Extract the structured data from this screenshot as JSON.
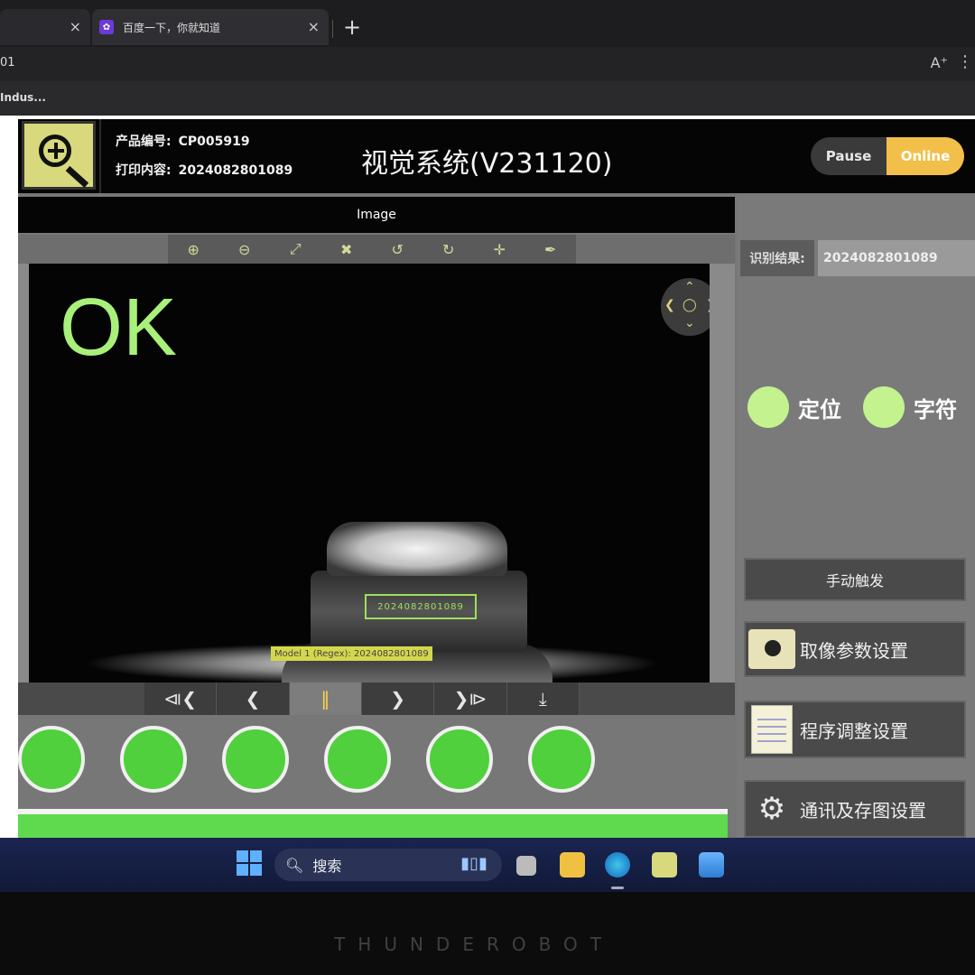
{
  "browser": {
    "tab1_close": "×",
    "tab2_title": "百度一下，你就知道",
    "tab2_close": "×",
    "new_tab": "+",
    "url_fragment": "01",
    "reader_icon": "A⁺",
    "favorite_fragment": "Indus..."
  },
  "header": {
    "product_no_label": "产品编号:",
    "product_no": "CP005919",
    "print_label": "打印内容:",
    "print_content": "2024082801089",
    "title": "视觉系统(V231120)",
    "pause_label": "Pause",
    "online_label": "Online"
  },
  "image_panel": {
    "title": "Image",
    "tools": [
      {
        "name": "zoom-in-icon",
        "glyph": "⊕"
      },
      {
        "name": "zoom-out-icon",
        "glyph": "⊖"
      },
      {
        "name": "fit-icon",
        "glyph": "⤢"
      },
      {
        "name": "expand-icon",
        "glyph": "✖"
      },
      {
        "name": "rotate-left-icon",
        "glyph": "↺"
      },
      {
        "name": "rotate-right-icon",
        "glyph": "↻"
      },
      {
        "name": "move-icon",
        "glyph": "✛"
      },
      {
        "name": "picker-icon",
        "glyph": "✒"
      }
    ],
    "ok_text": "OK",
    "code_text": "2024082801089",
    "model_label": "Model 1 (Regex): 2024082801089",
    "media": [
      "⧏❮",
      "❮",
      "‖",
      "❯",
      "❯⧐",
      "⤓"
    ]
  },
  "lights": {
    "count": 6,
    "color": "#4fd03c"
  },
  "result": {
    "label": "识别结果:",
    "value": "2024082801089",
    "indicator1_label": "定位",
    "indicator2_label": "字符",
    "indicator_color": "#c3f28f"
  },
  "actions": {
    "manual_trigger": "手动触发",
    "camera_settings": "取像参数设置",
    "program_settings": "程序调整设置",
    "comm_settings": "通讯及存图设置"
  },
  "taskbar": {
    "search_label": "搜索"
  },
  "monitor_brand": "THUNDEROBOT"
}
